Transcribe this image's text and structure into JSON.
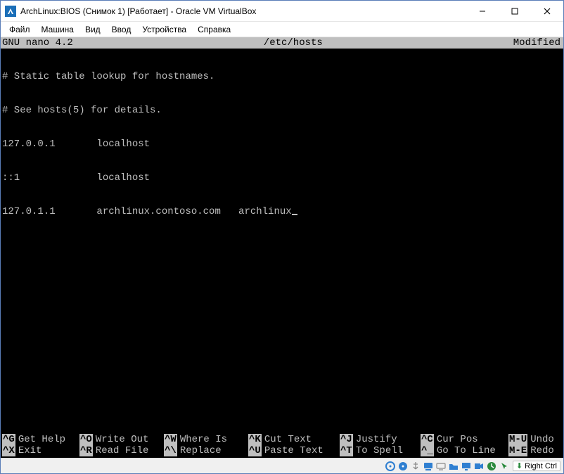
{
  "window": {
    "title": "ArchLinux:BIOS (Снимок 1) [Работает] - Oracle VM VirtualBox"
  },
  "menu": {
    "items": [
      "Файл",
      "Машина",
      "Вид",
      "Ввод",
      "Устройства",
      "Справка"
    ]
  },
  "nano": {
    "app": " GNU nano 4.2",
    "file": "/etc/hosts",
    "status": "Modified",
    "lines": [
      "# Static table lookup for hostnames.",
      "# See hosts(5) for details.",
      "127.0.0.1       localhost",
      "::1             localhost",
      "127.0.1.1       archlinux.contoso.com   archlinux"
    ],
    "shortcuts_row1": [
      {
        "key": "^G",
        "label": "Get Help"
      },
      {
        "key": "^O",
        "label": "Write Out"
      },
      {
        "key": "^W",
        "label": "Where Is"
      },
      {
        "key": "^K",
        "label": "Cut Text"
      },
      {
        "key": "^J",
        "label": "Justify"
      },
      {
        "key": "^C",
        "label": "Cur Pos"
      },
      {
        "key": "M-U",
        "label": "Undo"
      }
    ],
    "shortcuts_row2": [
      {
        "key": "^X",
        "label": "Exit"
      },
      {
        "key": "^R",
        "label": "Read File"
      },
      {
        "key": "^\\",
        "label": "Replace"
      },
      {
        "key": "^U",
        "label": "Paste Text"
      },
      {
        "key": "^T",
        "label": "To Spell"
      },
      {
        "key": "^_",
        "label": "Go To Line"
      },
      {
        "key": "M-E",
        "label": "Redo"
      }
    ]
  },
  "statusbar": {
    "hostkey": "Right Ctrl",
    "icons": [
      "disc",
      "cd",
      "usb",
      "audio",
      "net",
      "share",
      "display",
      "record",
      "cpu",
      "mouse"
    ]
  },
  "colors": {
    "icon_blue": "#2f7fd1",
    "icon_green": "#2b8a3e",
    "icon_yellow": "#d4a017",
    "icon_gray": "#8a8a8a"
  }
}
